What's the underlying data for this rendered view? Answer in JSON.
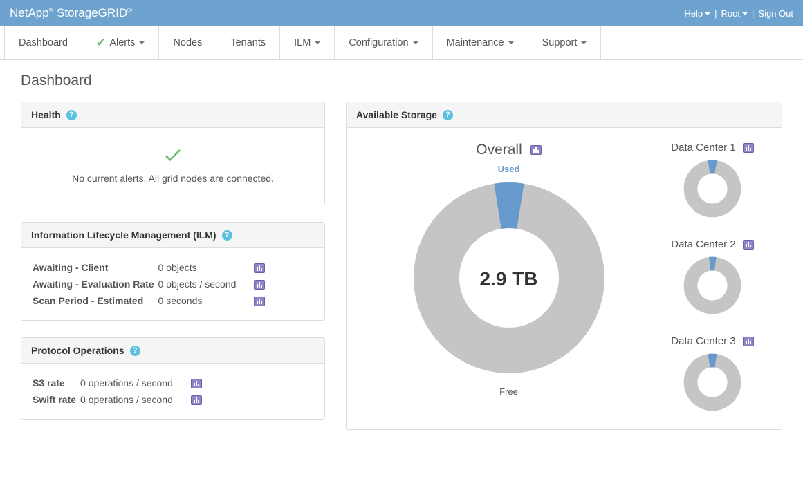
{
  "brand": {
    "company": "NetApp",
    "product": "StorageGRID"
  },
  "topLinks": {
    "help": "Help",
    "user": "Root",
    "signout": "Sign Out"
  },
  "menu": {
    "dashboard": "Dashboard",
    "alerts": "Alerts",
    "nodes": "Nodes",
    "tenants": "Tenants",
    "ilm": "ILM",
    "configuration": "Configuration",
    "maintenance": "Maintenance",
    "support": "Support"
  },
  "pageTitle": "Dashboard",
  "health": {
    "title": "Health",
    "message": "No current alerts. All grid nodes are connected."
  },
  "ilm": {
    "title": "Information Lifecycle Management (ILM)",
    "rows": {
      "awaitingClient": {
        "label": "Awaiting - Client",
        "value": "0 objects"
      },
      "awaitingEval": {
        "label": "Awaiting - Evaluation Rate",
        "value": "0 objects / second"
      },
      "scanPeriod": {
        "label": "Scan Period - Estimated",
        "value": "0 seconds"
      }
    }
  },
  "protocol": {
    "title": "Protocol Operations",
    "rows": {
      "s3": {
        "label": "S3 rate",
        "value": "0 operations / second"
      },
      "swift": {
        "label": "Swift rate",
        "value": "0 operations / second"
      }
    }
  },
  "storage": {
    "title": "Available Storage",
    "overallLabel": "Overall",
    "usedLabel": "Used",
    "freeLabel": "Free",
    "centerValue": "2.9 TB",
    "dc": {
      "dc1": "Data Center 1",
      "dc2": "Data Center 2",
      "dc3": "Data Center 3"
    }
  },
  "chart_data": [
    {
      "type": "pie",
      "title": "Overall",
      "series": [
        {
          "name": "Used",
          "value": 5,
          "color": "#6699cc"
        },
        {
          "name": "Free",
          "value": 95,
          "color": "#c5c5c5"
        }
      ],
      "center_label": "2.9 TB"
    },
    {
      "type": "pie",
      "title": "Data Center 1",
      "series": [
        {
          "name": "Used",
          "value": 5,
          "color": "#6699cc"
        },
        {
          "name": "Free",
          "value": 95,
          "color": "#c5c5c5"
        }
      ]
    },
    {
      "type": "pie",
      "title": "Data Center 2",
      "series": [
        {
          "name": "Used",
          "value": 4,
          "color": "#6699cc"
        },
        {
          "name": "Free",
          "value": 96,
          "color": "#c5c5c5"
        }
      ]
    },
    {
      "type": "pie",
      "title": "Data Center 3",
      "series": [
        {
          "name": "Used",
          "value": 5,
          "color": "#6699cc"
        },
        {
          "name": "Free",
          "value": 95,
          "color": "#c5c5c5"
        }
      ]
    }
  ]
}
